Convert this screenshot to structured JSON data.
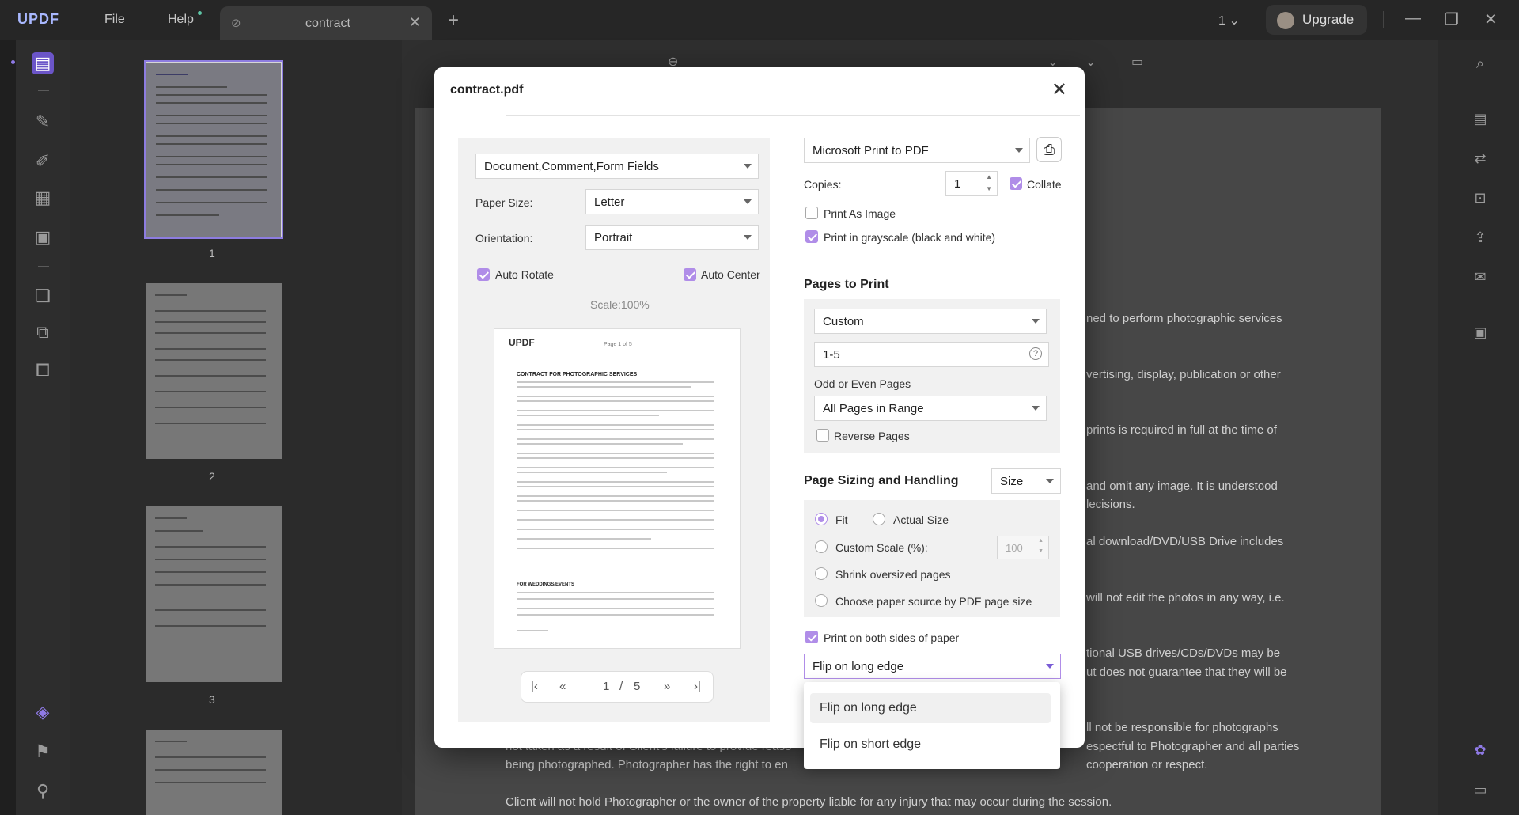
{
  "titlebar": {
    "logo": "UPDF",
    "menu_file": "File",
    "menu_help": "Help",
    "tab_title": "contract",
    "page_indicator": "1",
    "upgrade_label": "Upgrade"
  },
  "thumbnails": {
    "pages": [
      {
        "number": "1"
      },
      {
        "number": "2"
      },
      {
        "number": "3"
      }
    ]
  },
  "document_text": [
    "ned to perform photographic services",
    "vertising, display, publication or other",
    "prints is required in full at the time of",
    "and omit any image. It is understood",
    "lecisions.",
    "al download/DVD/USB Drive includes",
    "will not edit the photos in any way, i.e.",
    "tional USB drives/CDs/DVDs may be",
    "ut does not guarantee that they will be",
    "ll not be responsible for photographs",
    "not taken as a result of Client's failure to provide reaso",
    "espectful to Photographer and all parties",
    "being photographed. Photographer has the right to en",
    "cooperation or respect.",
    "Client will not hold Photographer or the owner of the property liable for any injury that may occur during the session."
  ],
  "dialog": {
    "title": "contract.pdf",
    "content_select": "Document,Comment,Form Fields",
    "paper_size_label": "Paper Size:",
    "paper_size_value": "Letter",
    "orientation_label": "Orientation:",
    "orientation_value": "Portrait",
    "auto_rotate_label": "Auto Rotate",
    "auto_rotate_checked": true,
    "auto_center_label": "Auto Center",
    "auto_center_checked": true,
    "scale_label": "Scale:100%",
    "pager": {
      "current": "1",
      "separator": "/",
      "total": "5"
    },
    "printer": "Microsoft Print to PDF",
    "copies_label": "Copies:",
    "copies_value": "1",
    "collate_label": "Collate",
    "collate_checked": true,
    "print_as_image_label": "Print As Image",
    "print_as_image_checked": false,
    "grayscale_label": "Print in grayscale (black and white)",
    "grayscale_checked": true,
    "pages_to_print": {
      "heading": "Pages to Print",
      "range_mode": "Custom",
      "range_value": "1-5",
      "odd_even_label": "Odd or Even Pages",
      "odd_even_value": "All Pages in Range",
      "reverse_label": "Reverse Pages",
      "reverse_checked": false
    },
    "page_sizing": {
      "heading": "Page Sizing and Handling",
      "mode": "Size",
      "fit_label": "Fit",
      "actual_size_label": "Actual Size",
      "custom_scale_label": "Custom Scale (%):",
      "custom_scale_value": "100",
      "shrink_label": "Shrink oversized pages",
      "paper_source_label": "Choose paper source by PDF page size",
      "selected": "fit"
    },
    "duplex_label": "Print on both sides of paper",
    "duplex_checked": true,
    "flip_value": "Flip on long edge",
    "flip_options": [
      "Flip on long edge",
      "Flip on short edge"
    ]
  },
  "preview": {
    "logo": "UPDF",
    "page_label": "Page 1 of 5",
    "heading": "CONTRACT FOR PHOTOGRAPHIC SERVICES",
    "subheading": "FOR WEDDINGS/EVENTS"
  },
  "colors": {
    "accent": "#b08de8",
    "rail_active": "#6b55c8"
  }
}
